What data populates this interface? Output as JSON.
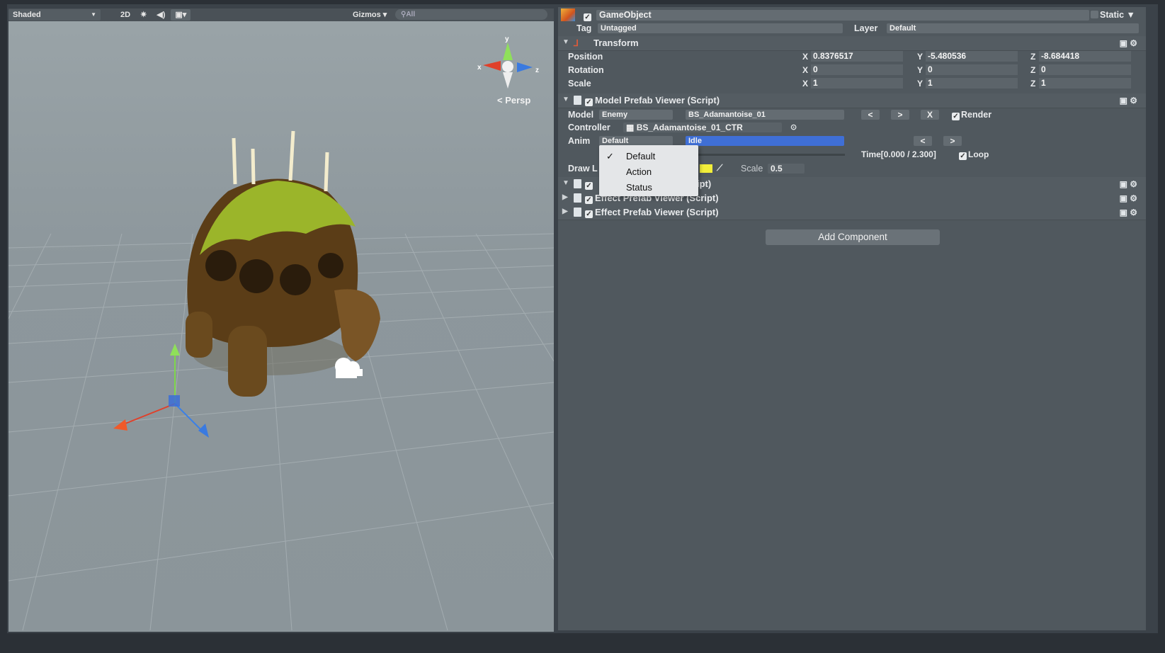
{
  "toolbar": {
    "shading_mode": "Shaded",
    "two_d": "2D",
    "gizmos": "Gizmos",
    "search_placeholder": "All"
  },
  "scene": {
    "projection_label": "Persp",
    "gizmo_axes": [
      "y",
      "x",
      "z"
    ]
  },
  "inspector": {
    "object_name": "GameObject",
    "static_label": "Static",
    "tag_label": "Tag",
    "tag_value": "Untagged",
    "layer_label": "Layer",
    "layer_value": "Default",
    "transform": {
      "title": "Transform",
      "position": {
        "label": "Position",
        "x": "0.8376517",
        "y": "-5.480536",
        "z": "-8.684418"
      },
      "rotation": {
        "label": "Rotation",
        "x": "0",
        "y": "0",
        "z": "0"
      },
      "scale": {
        "label": "Scale",
        "x": "1",
        "y": "1",
        "z": "1"
      }
    },
    "model_viewer": {
      "title": "Model Prefab Viewer (Script)",
      "model_label": "Model",
      "model_category": "Enemy",
      "model_name": "BS_Adamantoise_01",
      "prev": "<",
      "next": ">",
      "close": "X",
      "render_label": "Render",
      "controller_label": "Controller",
      "controller_value": "BS_Adamantoise_01_CTR",
      "anim_label": "Anim",
      "anim_category": "Default",
      "anim_value": "Idle",
      "time_label": "Time[0.000 / 2.300]",
      "loop_label": "Loop",
      "draw_label": "Draw L",
      "scale_label": "Scale",
      "scale_value": "0.5"
    },
    "other_components": [
      {
        "title": "ipt)"
      },
      {
        "title": "Effect Prefab Viewer (Script)"
      },
      {
        "title": "Effect Prefab Viewer (Script)"
      }
    ],
    "add_component": "Add Component"
  },
  "dropdown_menu": {
    "items": [
      "Default",
      "Action",
      "Status"
    ],
    "selected": "Default"
  },
  "colors": {
    "inspector_bg": "#50585e",
    "selection_blue": "#3f6fd6",
    "scene_bg": "#8d979c"
  }
}
